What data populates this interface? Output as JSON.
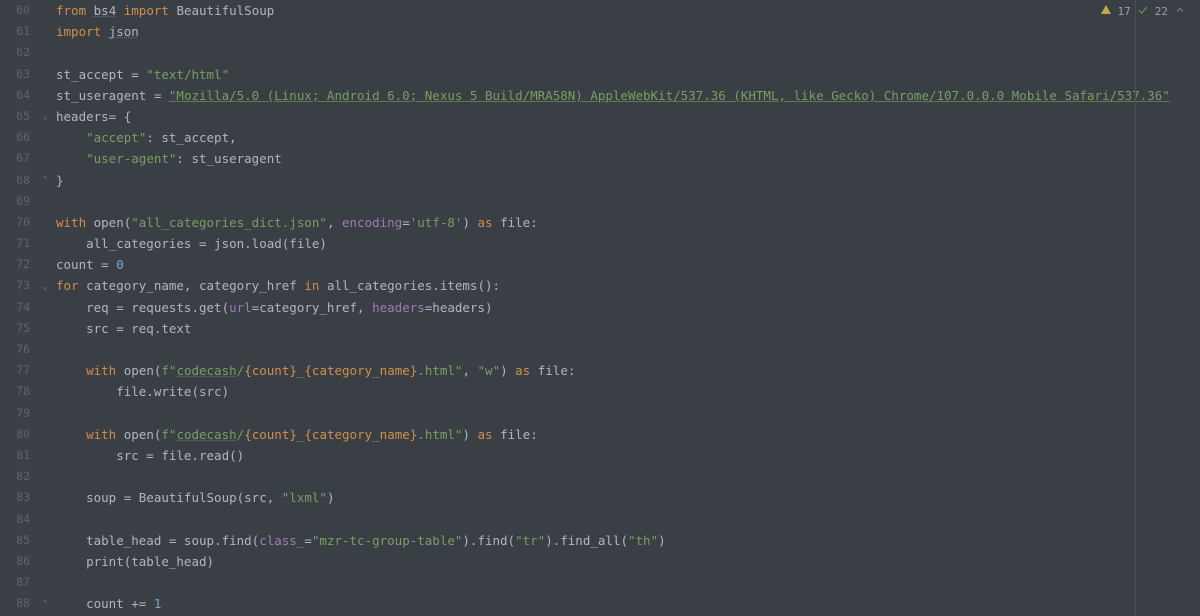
{
  "status": {
    "warnings": "17",
    "passes": "22"
  },
  "gutter": {
    "start": 60,
    "count": 29
  },
  "folds": [
    {
      "line": 65,
      "glyph": "⌄"
    },
    {
      "line": 68,
      "glyph": "⌃"
    },
    {
      "line": 73,
      "glyph": "⌄"
    },
    {
      "line": 88,
      "glyph": "⌃"
    }
  ],
  "code": {
    "l60": {
      "from": "from",
      "bs4": "bs4",
      "import": "import",
      "beautiful": "BeautifulSoup"
    },
    "l61": {
      "import": "import",
      "json": "json"
    },
    "l63": {
      "var": "st_accept = ",
      "str": "\"text/html\""
    },
    "l64": {
      "var": "st_useragent = ",
      "str": "\"Mozilla/5.0 (Linux; Android 6.0; Nexus 5 Build/MRA58N) AppleWebKit/537.36 (KHTML, like Gecko) Chrome/107.0.0.0 Mobile Safari/537.36\""
    },
    "l65": {
      "txt": "headers= {"
    },
    "l66": {
      "key": "\"accept\"",
      "sep": ": st_accept,"
    },
    "l67": {
      "key": "\"user-agent\"",
      "sep": ": st_useragent"
    },
    "l68": {
      "txt": "}"
    },
    "l70": {
      "with": "with",
      "open": " open(",
      "arg1": "\"all_categories_dict.json\"",
      "comma": ", ",
      "kw": "encoding",
      "eq": "=",
      "arg2": "'utf-8'",
      "close": ") ",
      "as": "as",
      "tail": " file:"
    },
    "l71": {
      "txt": "    all_categories = json.load(file)"
    },
    "l72": {
      "lhs": "count = ",
      "num": "0"
    },
    "l73": {
      "for": "for",
      "mid": " category_name, category_href ",
      "in": "in",
      "tail": " all_categories.items():"
    },
    "l74": {
      "lhs": "    req = requests.get(",
      "k1": "url",
      "eq1": "=category_href, ",
      "k2": "headers",
      "eq2": "=headers)"
    },
    "l75": {
      "txt": "    src = req.text"
    },
    "l77": {
      "ind": "    ",
      "with": "with",
      "open": " open(",
      "f": "f\"",
      "p1": "codecash",
      "p2": "/",
      "b1": "{count}",
      "u": "_",
      "b2": "{category_name}",
      "ext": ".html\"",
      "comma": ", ",
      "mode": "\"w\"",
      "close": ") ",
      "as": "as",
      "tail": " file:"
    },
    "l78": {
      "txt": "        file.write(src)"
    },
    "l80": {
      "ind": "    ",
      "with": "with",
      "open": " open(",
      "f": "f\"",
      "p1": "codecash",
      "p2": "/",
      "b1": "{count}",
      "u": "_",
      "b2": "{category_name}",
      "ext": ".html\"",
      "close": ") ",
      "as": "as",
      "tail": " file:"
    },
    "l81": {
      "txt": "        src = file.read()"
    },
    "l83": {
      "lhs": "    soup = BeautifulSoup(src, ",
      "str": "\"lxml\"",
      "close": ")"
    },
    "l85": {
      "lhs": "    table_head = soup.find(",
      "kw": "class_",
      "eq": "=",
      "s1": "\"mzr-tc-group-table\"",
      "mid": ").find(",
      "s2": "\"tr\"",
      "mid2": ").find_all(",
      "s3": "\"th\"",
      "close": ")"
    },
    "l86": {
      "txt": "    print(table_head)"
    },
    "l88": {
      "lhs": "    count += ",
      "num": "1"
    }
  }
}
